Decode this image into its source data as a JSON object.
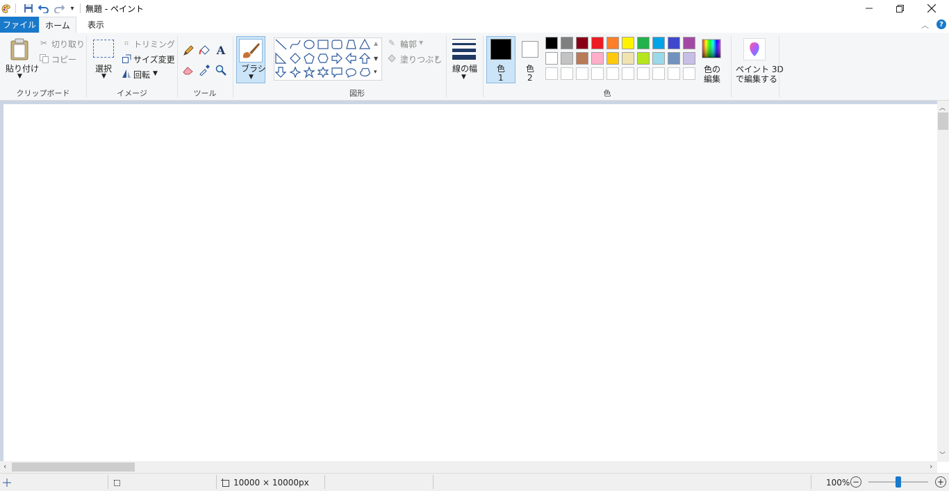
{
  "window": {
    "title": "無題 - ペイント",
    "minimize_icon": "minimize-icon",
    "restore_icon": "restore-icon",
    "close_icon": "close-icon"
  },
  "quick_access": {
    "save": "save-icon",
    "undo": "undo-icon",
    "redo": "redo-icon",
    "customize": "dropdown-arrow-icon"
  },
  "tabs": [
    {
      "label": "ファイル"
    },
    {
      "label": "ホーム"
    },
    {
      "label": "表示"
    }
  ],
  "ribbon": {
    "clipboard": {
      "paste": "貼り付け",
      "cut": "切り取り",
      "copy": "コピー",
      "group": "クリップボード"
    },
    "image": {
      "select": "選択",
      "crop": "トリミング",
      "resize": "サイズ変更",
      "rotate": "回転",
      "group": "イメージ"
    },
    "tools": {
      "group": "ツール",
      "text_icon_glyph": "A"
    },
    "brushes": {
      "label": "ブラシ"
    },
    "shapes": {
      "outline": "輪郭",
      "fill": "塗りつぶし",
      "group": "図形"
    },
    "size": {
      "label": "線の幅"
    },
    "colors": {
      "color1_label": "色",
      "color1_number": "1",
      "color2_label": "色",
      "color2_number": "2",
      "edit_line1": "色の",
      "edit_line2": "編集",
      "group": "色",
      "color1": "#000000",
      "color2": "#ffffff",
      "palette_row1": [
        "#000000",
        "#7f7f7f",
        "#880015",
        "#ed1c24",
        "#ff7f27",
        "#fff200",
        "#22b14c",
        "#00a2e8",
        "#3f48cc",
        "#a349a4"
      ],
      "palette_row2": [
        "#ffffff",
        "#c3c3c3",
        "#b97a57",
        "#ffaec9",
        "#ffc90e",
        "#efe4b0",
        "#b5e61d",
        "#99d9ea",
        "#7092be",
        "#c8bfe7"
      ]
    },
    "paint3d": {
      "line1": "ペイント 3D",
      "line2": "で編集する"
    }
  },
  "status": {
    "canvas_size": "10000 × 10000px",
    "zoom": "100%",
    "zoom_level_percent": 100
  }
}
